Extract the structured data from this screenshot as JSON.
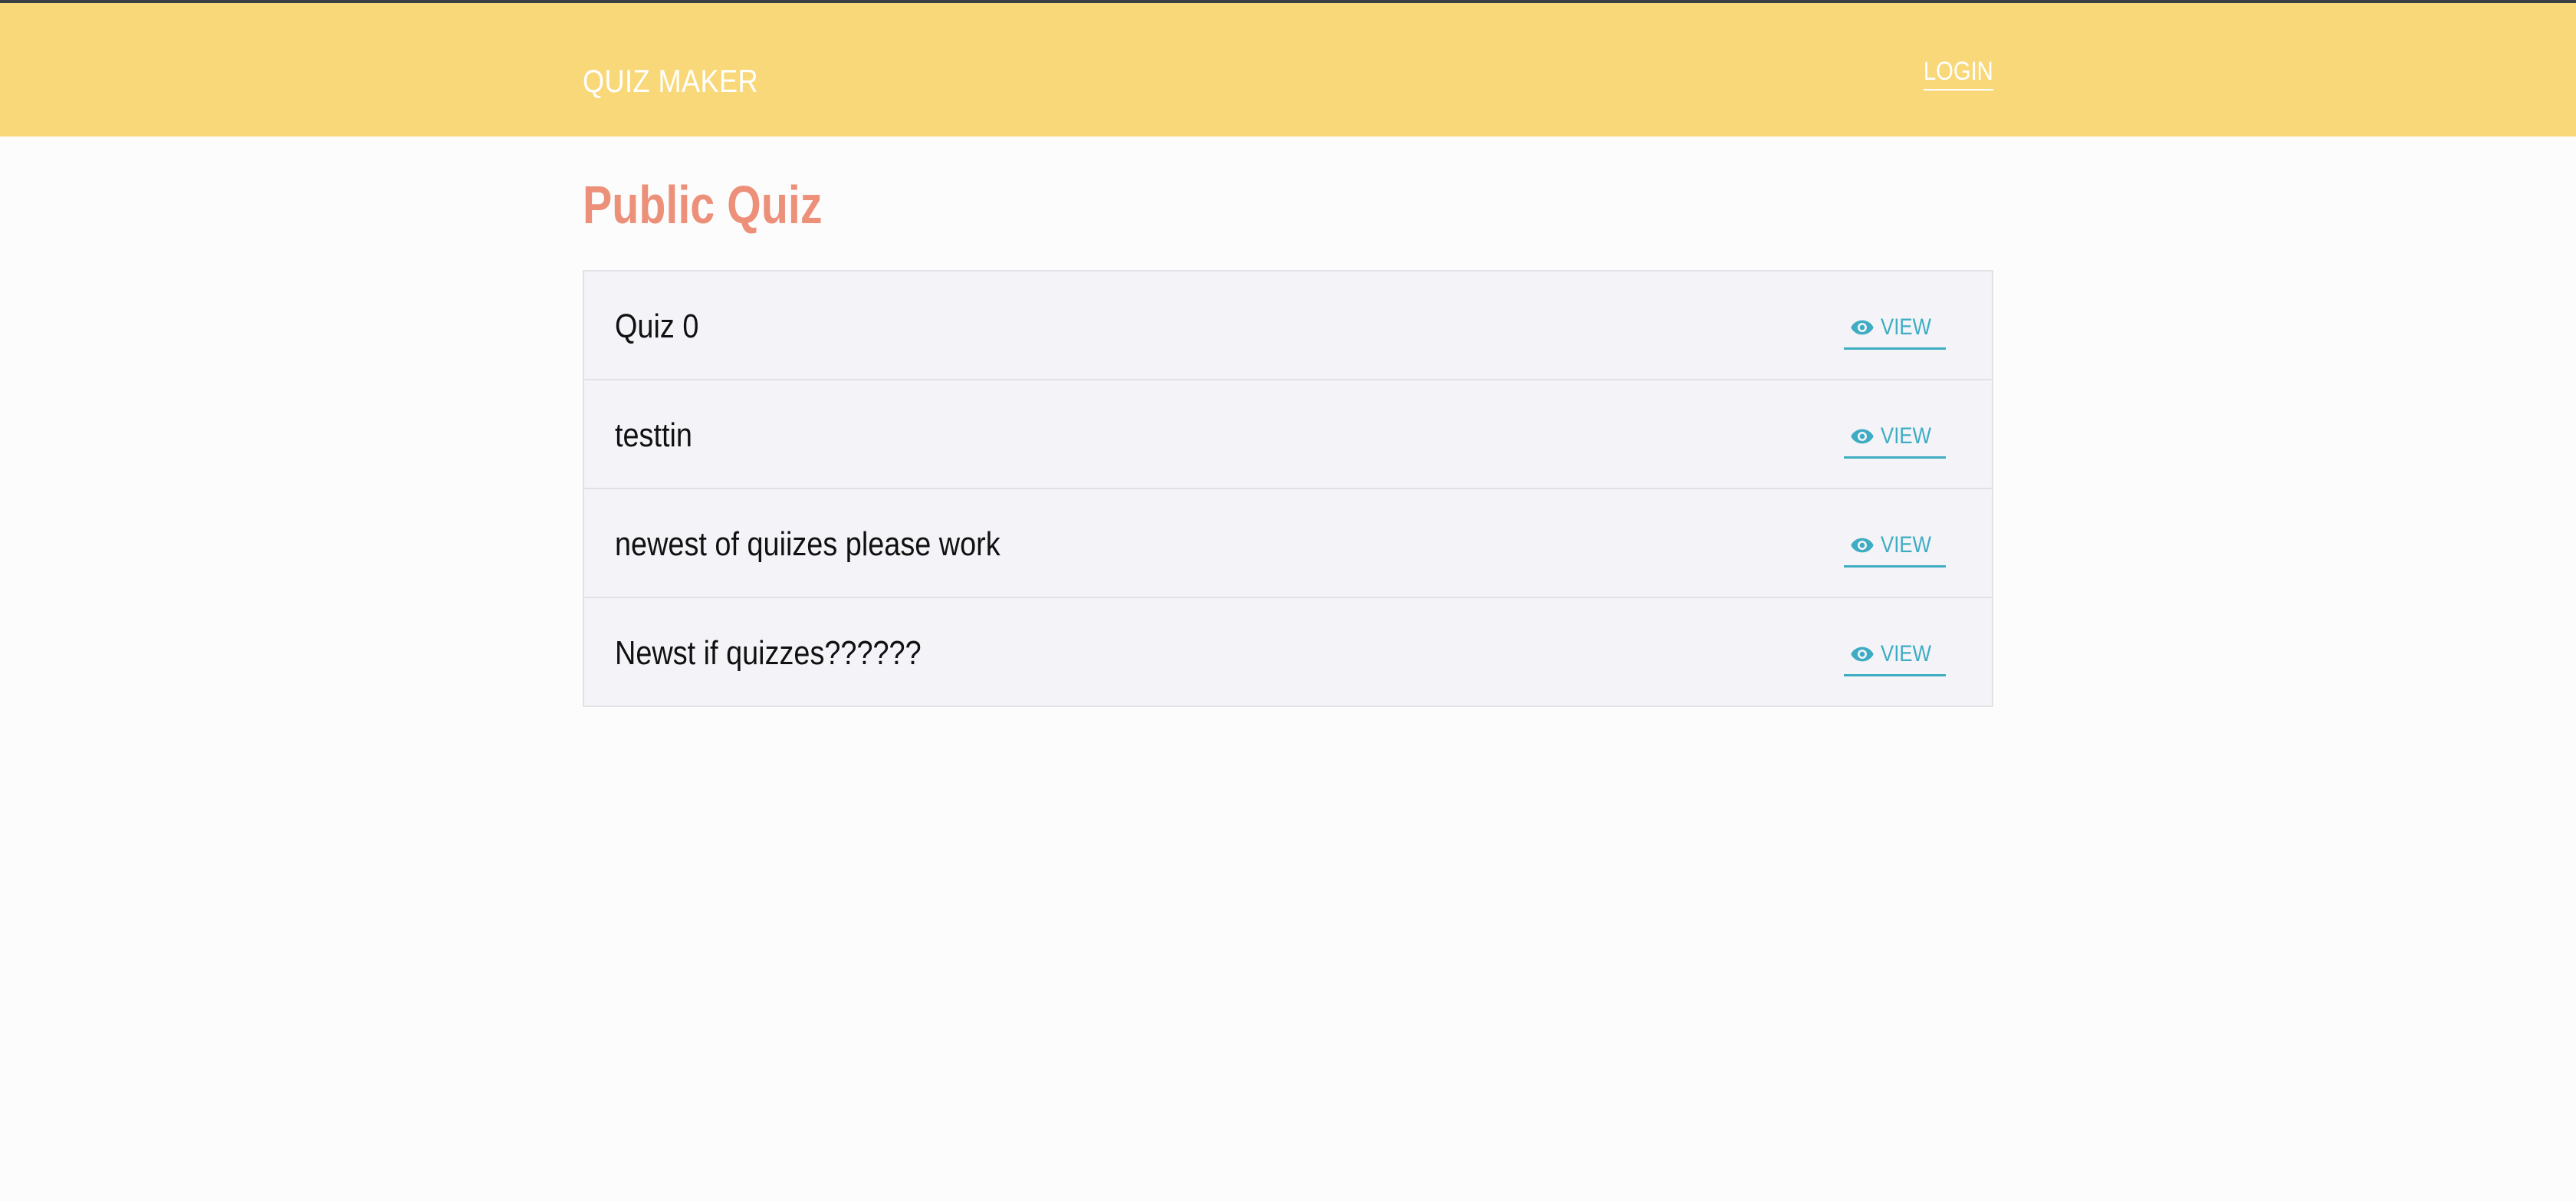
{
  "header": {
    "brand": "QUIZ MAKER",
    "login_label": "LOGIN"
  },
  "main": {
    "title": "Public Quiz",
    "quizzes": [
      {
        "name": "Quiz 0",
        "action_label": "VIEW",
        "action_icon": "eye-icon"
      },
      {
        "name": "testtin",
        "action_label": "VIEW",
        "action_icon": "eye-icon"
      },
      {
        "name": "newest of quiizes please work",
        "action_label": "VIEW",
        "action_icon": "eye-icon"
      },
      {
        "name": "Newst if quizzes??????",
        "action_label": "VIEW",
        "action_icon": "eye-icon"
      }
    ]
  },
  "colors": {
    "header_bg": "#f9d87a",
    "title": "#ec9079",
    "accent": "#3eacc3",
    "row_bg": "#f4f4f8"
  }
}
